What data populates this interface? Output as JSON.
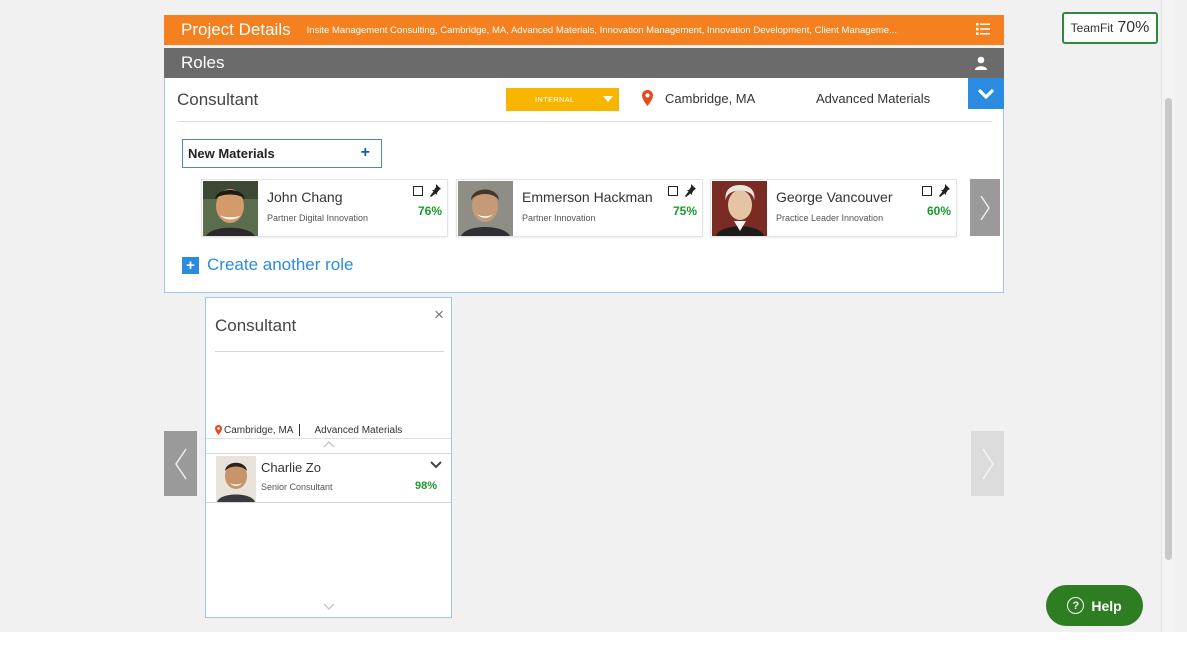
{
  "teamfit": {
    "label": "TeamFit",
    "value": "70%"
  },
  "project_bar": {
    "title": "Project Details",
    "breadcrumb": "Insite Management Consulting, Cambridge, MA, Advanced Materials, Innovation Management, Innovation Development, Client Manageme..."
  },
  "roles_bar": {
    "title": "Roles"
  },
  "role": {
    "title": "Consultant",
    "type_dropdown": "INTERNAL",
    "location": "Cambridge, MA",
    "practice": "Advanced Materials"
  },
  "skill_field": {
    "value": "New Materials",
    "add_symbol": "+"
  },
  "candidates": [
    {
      "name": "John Chang",
      "title": "Partner Digital Innovation",
      "match": "76%"
    },
    {
      "name": "Emmerson Hackman",
      "title": "Partner Innovation",
      "match": "75%"
    },
    {
      "name": "George Vancouver",
      "title": "Practice Leader Innovation",
      "match": "60%"
    }
  ],
  "create_role": {
    "icon": "+",
    "label": "Create another role"
  },
  "role_card": {
    "title": "Consultant",
    "close": "×",
    "location": "Cambridge, MA",
    "practice": "Advanced Materials",
    "member": {
      "name": "Charlie Zo",
      "title": "Senior Consultant",
      "match": "98%"
    }
  },
  "help": {
    "icon": "?",
    "label": "Help"
  },
  "colors": {
    "project_bar": "#f48020",
    "roles_bar": "#6b6b6b",
    "accent_blue": "#2a8be0",
    "dropdown": "#f8b500",
    "match_green": "#1a9a2e",
    "help": "#2f7d23"
  }
}
